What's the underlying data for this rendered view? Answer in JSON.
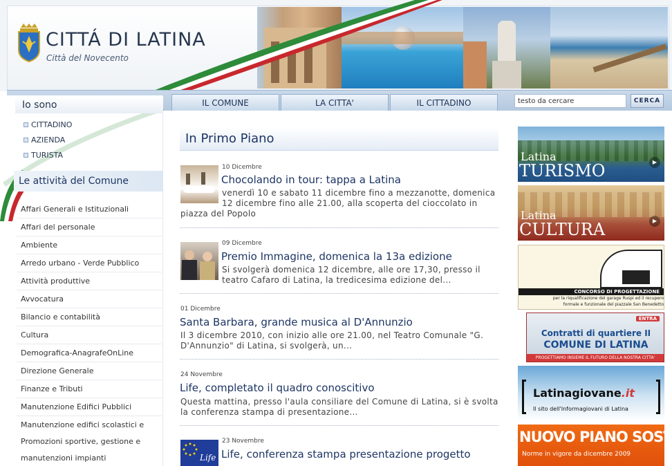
{
  "header": {
    "title": "CITTÁ DI LATINA",
    "subtitle": "Città del Novecento"
  },
  "nav": {
    "tabs": [
      "IL COMUNE",
      "LA CITTA'",
      "IL CITTADINO"
    ],
    "search_value": "testo da cercare",
    "search_button": "CERCA"
  },
  "sidebar": {
    "iosono_title": "Io sono",
    "iosono_items": [
      "CITTADINO",
      "AZIENDA",
      "TURISTA"
    ],
    "attivita_title": "Le attività del Comune",
    "categories": [
      "Affari Generali e Istituzionali",
      "Affari del personale",
      "Ambiente",
      "Arredo urbano - Verde Pubblico",
      "Attività produttive",
      "Avvocatura",
      "Bilancio e contabilità",
      "Cultura",
      "Demografica-AnagrafeOnLine",
      "Direzione Generale",
      "Finanze e Tributi",
      "Manutenzione Edifici Pubblici",
      "Manutenzione edifici scolastici e",
      "Promozioni sportive, gestione e",
      "manutenzioni impianti"
    ]
  },
  "main": {
    "section_title": "In Primo Piano",
    "news": [
      {
        "date": "10 Dicembre",
        "title": "Chocolando in tour: tappa a Latina",
        "body_line1": "venerdì 10 e sabato 11 dicembre fino a mezzanotte, domenica",
        "body_line2": "12 dicembre fino alle 21.00, alla scoperta del cioccolato in",
        "body_line3": "piazza del Popolo"
      },
      {
        "date": "09 Dicembre",
        "title": "Premio Immagine, domenica la 13a edizione",
        "body_line1": "Si svolgerà domenica 12 dicembre, alle ore 17,30, presso il",
        "body_line2": "teatro Cafaro di Latina, la tredicesima edizione del..."
      },
      {
        "date": "01 Dicembre",
        "title": "Santa Barbara, grande musica al D'Annunzio",
        "body_line1": "Il 3 dicembre 2010, con inizio alle ore 21.00, nel Teatro Comunale \"G.",
        "body_line2": "D'Annunzio\" di Latina, si svolgerà, un..."
      },
      {
        "date": "24 Novembre",
        "title": "Life, completato il quadro conoscitivo",
        "body_line1": "Questa mattina, presso l'aula consiliare del Comune di Latina, si è svolta",
        "body_line2": "la conferenza stampa di presentazione..."
      },
      {
        "date": "23 Novembre",
        "title": "Life, conferenza stampa presentazione progetto"
      }
    ]
  },
  "banners": {
    "turismo_small": "Latina",
    "turismo_big": "TURISMO",
    "cultura_small": "Latina",
    "cultura_big": "CULTURA",
    "concorso_title": "CONCORSO DI PROGETTAZIONE",
    "concorso_sub1": "per la riqualificazione del garage Ruspi ed il recupero",
    "concorso_sub2": "formale e funzionale del piazzale San Benedetto",
    "contratti_entra": "ENTRA",
    "contratti_line1": "Contratti di quartiere II",
    "contratti_line2": "COMUNE DI LATINA",
    "contratti_line3": "PROGETTIAMO INSIEME IL FUTURO DELLA NOSTRA CITTA'",
    "giovane_main": "Latinagiovane",
    "giovane_it": ".it",
    "giovane_sub": "Il sito dell'Informagiovani di Latina",
    "sosta_title": "NUOVO PIANO SOSTA",
    "sosta_sub": "Norme in vigore da dicembre 2009"
  },
  "colors": {
    "nav_bg": "#b4c8de",
    "title_blue": "#1d3563",
    "ribbon_green": "#2e8b3a",
    "ribbon_red": "#c8282d",
    "banner_turismo": "#2a5d8f",
    "banner_cultura": "#8f2a1f",
    "banner_sosta": "#ea5a0b"
  }
}
